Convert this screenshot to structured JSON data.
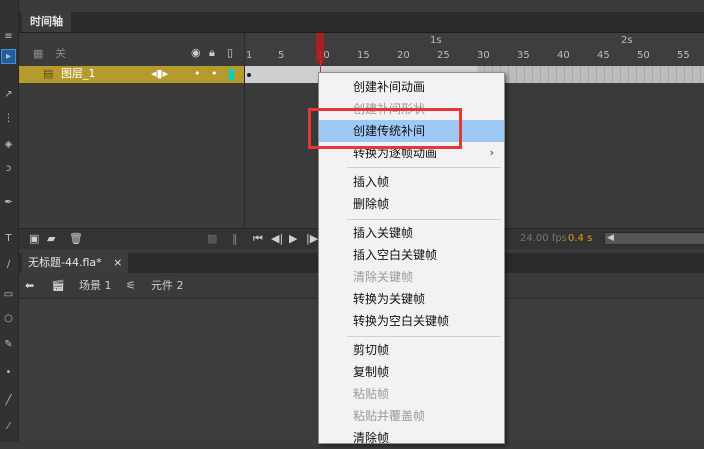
{
  "timeline": {
    "tab_label": "时间轴",
    "header_layer_name": "关",
    "header_icons": [
      "eye-icon",
      "lock-icon",
      "outline-icon"
    ],
    "seconds": [
      "1s",
      "2s"
    ],
    "frame_numbers": [
      "1",
      "5",
      "10",
      "15",
      "20",
      "25",
      "30",
      "35",
      "40",
      "45",
      "50",
      "55"
    ],
    "layer": {
      "name": "图层_1",
      "color": "#00d4c4"
    },
    "status": {
      "fps": "24.00 fps",
      "time": "0.4 s"
    }
  },
  "document": {
    "tab_label": "无标题-44.fla*",
    "close_glyph": "×",
    "scene_label": "场景 1",
    "symbol_label": "元件 2"
  },
  "context_menu": {
    "items": [
      {
        "label": "创建补间动画",
        "enabled": true
      },
      {
        "label": "创建补间形状",
        "enabled": false
      },
      {
        "label": "创建传统补间",
        "enabled": true,
        "highlighted": true
      },
      {
        "label": "转换为逐帧动画",
        "enabled": true,
        "submenu": true
      },
      {
        "label": "插入帧",
        "enabled": true
      },
      {
        "label": "删除帧",
        "enabled": true
      },
      {
        "label": "插入关键帧",
        "enabled": true
      },
      {
        "label": "插入空白关键帧",
        "enabled": true
      },
      {
        "label": "清除关键帧",
        "enabled": false
      },
      {
        "label": "转换为关键帧",
        "enabled": true
      },
      {
        "label": "转换为空白关键帧",
        "enabled": true
      },
      {
        "label": "剪切帧",
        "enabled": true
      },
      {
        "label": "复制帧",
        "enabled": true
      },
      {
        "label": "粘贴帧",
        "enabled": false
      },
      {
        "label": "粘贴并覆盖帧",
        "enabled": false
      },
      {
        "label": "清除帧",
        "enabled": true
      }
    ],
    "submenu_glyph": "›"
  },
  "colors": {
    "highlight": "#9ec9f5",
    "annotation": "#e53935",
    "layer_row": "#b79a2e",
    "playhead": "#d32f2f"
  }
}
